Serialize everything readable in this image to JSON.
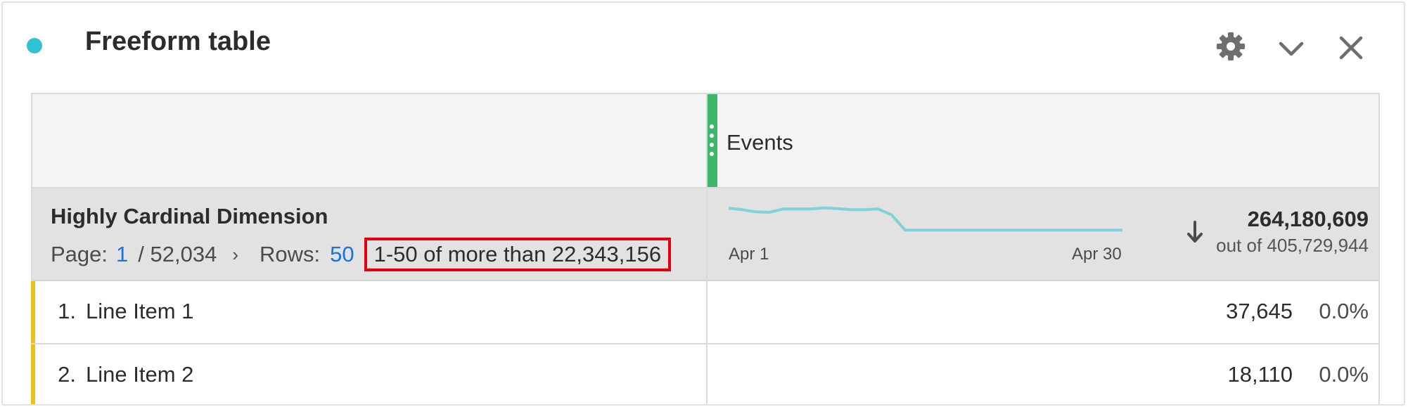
{
  "panel": {
    "title": "Freeform table",
    "status_color": "#2fc3d1",
    "icons": [
      "gear-icon",
      "chevron-down-icon",
      "close-icon"
    ]
  },
  "table": {
    "metric": {
      "label": "Events",
      "color": "#3db86a",
      "total": "264,180,609",
      "total_of": "out of 405,729,944",
      "sparkline": {
        "start_label": "Apr 1",
        "end_label": "Apr 30",
        "color": "#7dd3d9",
        "relative_values": [
          0.88,
          0.84,
          0.78,
          0.77,
          0.86,
          0.86,
          0.86,
          0.89,
          0.87,
          0.84,
          0.84,
          0.86,
          0.7,
          0.28,
          0.28,
          0.28,
          0.28,
          0.28,
          0.28,
          0.28,
          0.28,
          0.28,
          0.28,
          0.28,
          0.28,
          0.28,
          0.28,
          0.28,
          0.28,
          0.28
        ]
      }
    },
    "dimension": {
      "name": "Highly Cardinal Dimension",
      "page_label": "Page:",
      "page_current": "1",
      "page_total": "/ 52,034",
      "next_glyph": "›",
      "rows_label": "Rows:",
      "rows_value": "50",
      "range_text": "1-50 of more than 22,343,156",
      "highlight_color": "#e0000f"
    },
    "rows": [
      {
        "number": "1.",
        "label": "Line Item 1",
        "value": "37,645",
        "percent": "0.0%"
      },
      {
        "number": "2.",
        "label": "Line Item 2",
        "value": "18,110",
        "percent": "0.0%"
      }
    ],
    "row_accent_color": "#e8c21e"
  }
}
